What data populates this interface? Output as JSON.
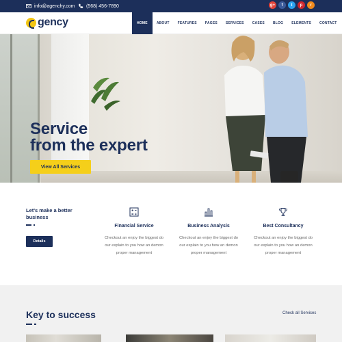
{
  "topbar": {
    "email": "info@agenchy.com",
    "phone": "(568) 456-7890",
    "social": [
      {
        "name": "google-plus",
        "glyph": "g+",
        "color": "#e0443a"
      },
      {
        "name": "facebook",
        "glyph": "f",
        "color": "#3b5b9a"
      },
      {
        "name": "twitter",
        "glyph": "t",
        "color": "#2aa3ef"
      },
      {
        "name": "pinterest",
        "glyph": "p",
        "color": "#d0282e"
      },
      {
        "name": "rss",
        "glyph": "r",
        "color": "#f08a1c"
      }
    ]
  },
  "brand": {
    "name": "gency"
  },
  "nav": {
    "items": [
      "HOME",
      "ABOUT",
      "FEATURES",
      "PAGES",
      "SERVICES",
      "CASES",
      "BLOG",
      "ELEMENTS",
      "CONTACT"
    ],
    "active": "HOME"
  },
  "hero": {
    "title_line1": "Service",
    "title_line2": "from the expert",
    "button": "View All Services"
  },
  "intro": {
    "heading_line1": "Let's make a better",
    "heading_line2": "business",
    "button": "Details"
  },
  "services": [
    {
      "title": "Financial Service",
      "desc_line1": "Checkout an enjoy the biggest do",
      "desc_line2": "our explain to you how an demon",
      "desc_line3": "proper management",
      "icon": "calculator-icon"
    },
    {
      "title": "Business Analysis",
      "desc_line1": "Checkout an enjoy the biggest do",
      "desc_line2": "our explain to you how an demon",
      "desc_line3": "proper management",
      "icon": "bar-chart-icon"
    },
    {
      "title": "Best Consultancy",
      "desc_line1": "Checkout an enjoy the biggest do",
      "desc_line2": "our explain to you how an demon",
      "desc_line3": "proper management",
      "icon": "trophy-icon"
    }
  ],
  "key": {
    "title": "Key to success",
    "link": "Check all Services"
  },
  "colors": {
    "navy": "#1c2f5a",
    "yellow": "#f5cf1a"
  }
}
